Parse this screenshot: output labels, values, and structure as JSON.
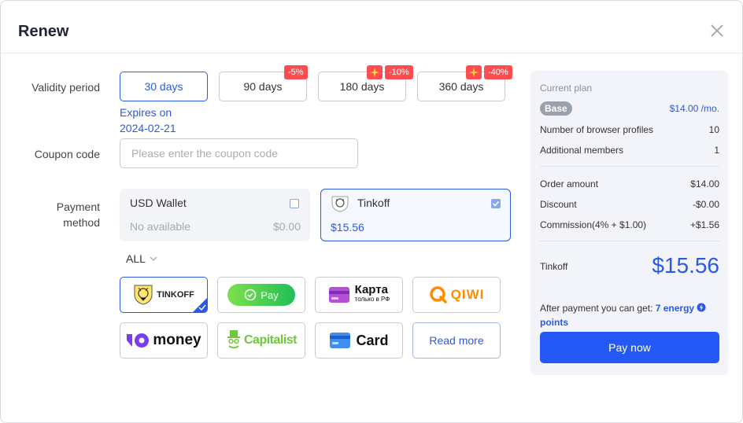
{
  "dialog": {
    "title": "Renew"
  },
  "validity": {
    "label": "Validity period",
    "options": [
      {
        "label": "30 days"
      },
      {
        "label": "90 days",
        "discount": "-5%"
      },
      {
        "label": "180 days",
        "discount": "-10%"
      },
      {
        "label": "360 days",
        "discount": "-40%"
      }
    ],
    "expires_line1": "Expires on",
    "expires_line2": "2024-02-21"
  },
  "coupon": {
    "label": "Coupon code",
    "placeholder": "Please enter the coupon code"
  },
  "payment": {
    "label_line1": "Payment",
    "label_line2": "method",
    "usd_wallet": {
      "name": "USD Wallet",
      "status": "No available",
      "amount": "$0.00"
    },
    "tinkoff": {
      "name": "Tinkoff",
      "amount": "$15.56"
    },
    "filter": "ALL",
    "methods": {
      "tinkoff": "TINKOFF",
      "pay": "Pay",
      "karta_line1": "Карта",
      "karta_line2": "только в РФ",
      "qiwi": "QIWI",
      "money": "money",
      "capitalist": "Capitalist",
      "card": "Card",
      "read_more": "Read more"
    }
  },
  "summary": {
    "current_plan_label": "Current plan",
    "plan_name": "Base",
    "plan_price": "$14.00 /mo.",
    "profiles_label": "Number of browser profiles",
    "profiles_value": "10",
    "members_label": "Additional members",
    "members_value": "1",
    "order_amount_label": "Order amount",
    "order_amount_value": "$14.00",
    "discount_label": "Discount",
    "discount_value": "-$0.00",
    "commission_label": "Commission(4% + $1.00)",
    "commission_value": "+$1.56",
    "method_label": "Tinkoff",
    "total": "$15.56",
    "energy_prefix": "After payment you can get: ",
    "energy_value": "7 energy",
    "energy_suffix": "points",
    "pay_button": "Pay now"
  },
  "colors": {
    "accent": "#2b59e6",
    "pay_button": "#2559f5",
    "badge": "#ff4d4f",
    "sidebar_bg": "#f2f4fa"
  }
}
